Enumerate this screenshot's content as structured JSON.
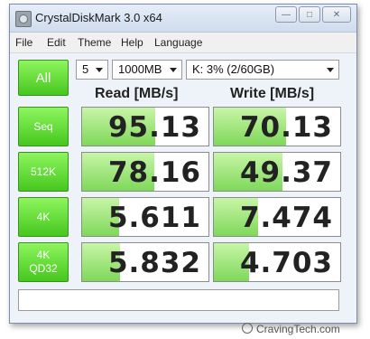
{
  "window": {
    "title": "CrystalDiskMark 3.0 x64"
  },
  "menu": [
    "File",
    "Edit",
    "Theme",
    "Help",
    "Language"
  ],
  "controls": {
    "all_label": "All",
    "test_count": "5",
    "test_size": "1000MB",
    "drive": "K: 3% (2/60GB)"
  },
  "headers": {
    "read": "Read [MB/s]",
    "write": "Write [MB/s]"
  },
  "rows": [
    {
      "label": "Seq",
      "read": "95.13",
      "write": "70.13",
      "read_fill": 0.58,
      "write_fill": 0.57
    },
    {
      "label": "512K",
      "read": "78.16",
      "write": "49.37",
      "read_fill": 0.57,
      "write_fill": 0.54
    },
    {
      "label": "4K",
      "read": "5.611",
      "write": "7.474",
      "read_fill": 0.29,
      "write_fill": 0.35
    },
    {
      "label_line1": "4K",
      "label_line2": "QD32",
      "read": "5.832",
      "write": "4.703",
      "read_fill": 0.3,
      "write_fill": 0.28
    }
  ],
  "comment": "",
  "watermark": "CravingTech.com",
  "colors": {
    "accent_green": "#46c71e",
    "fill_green": "#7fd85a"
  }
}
